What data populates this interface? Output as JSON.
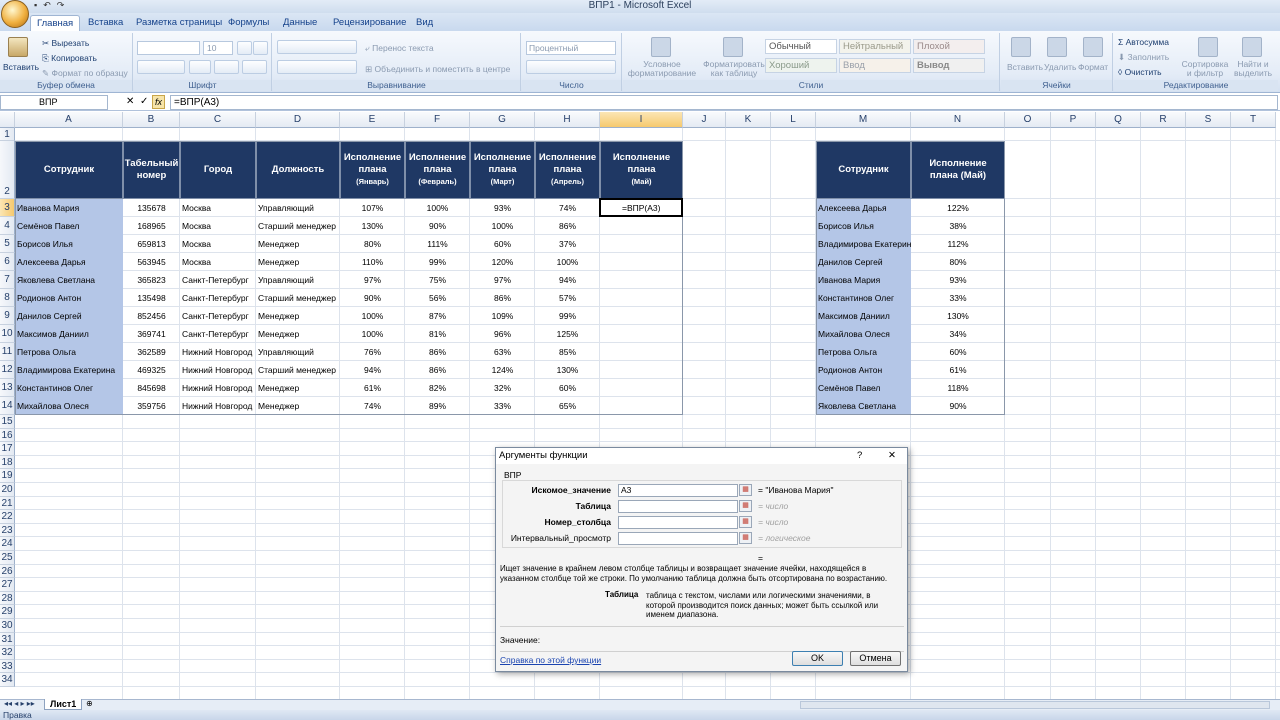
{
  "window": {
    "title": "ВПР1 - Microsoft Excel"
  },
  "tabs": [
    "Главная",
    "Вставка",
    "Разметка страницы",
    "Формулы",
    "Данные",
    "Рецензирование",
    "Вид"
  ],
  "ribbon": {
    "clipboard": {
      "paste": "Вставить",
      "cut": "Вырезать",
      "copy": "Копировать",
      "format_painter": "Формат по образцу",
      "label": "Буфер обмена"
    },
    "font": {
      "size": "10",
      "label": "Шрифт"
    },
    "alignment": {
      "wrap": "Перенос текста",
      "merge": "Объединить и поместить в центре",
      "label": "Выравнивание"
    },
    "number": {
      "format": "Процентный",
      "label": "Число"
    },
    "styles": {
      "cond_format": "Условное форматирование",
      "format_table": "Форматировать как таблицу",
      "cells": [
        "Обычный",
        "Нейтральный",
        "Плохой",
        "Хороший",
        "Ввод",
        "Вывод"
      ],
      "label": "Стили"
    },
    "cells": {
      "insert": "Вставить",
      "delete": "Удалить",
      "format": "Формат",
      "label": "Ячейки"
    },
    "editing": {
      "autosum": "Автосумма",
      "fill": "Заполнить",
      "clear": "Очистить",
      "sort": "Сортировка и фильтр",
      "find": "Найти и выделить",
      "label": "Редактирование"
    }
  },
  "formula_bar": {
    "name_box": "ВПР",
    "formula": "=ВПР(А3)"
  },
  "columns": [
    "A",
    "B",
    "C",
    "D",
    "E",
    "F",
    "G",
    "H",
    "I",
    "J",
    "K",
    "L",
    "M",
    "N",
    "O",
    "P",
    "Q",
    "R",
    "S",
    "T"
  ],
  "rows": [
    "1",
    "2",
    "3",
    "4",
    "5",
    "6",
    "7",
    "8",
    "9",
    "10",
    "11",
    "12",
    "13",
    "14",
    "15",
    "16",
    "17",
    "18",
    "19",
    "20",
    "21",
    "22",
    "23",
    "24",
    "25",
    "26",
    "27",
    "28",
    "29",
    "30",
    "31",
    "32",
    "33",
    "34"
  ],
  "table1": {
    "headers": {
      "employee": "Сотрудник",
      "tab_no": "Табельный номер",
      "city": "Город",
      "position": "Должность",
      "jan": [
        "Исполнение плана",
        "(Январь)"
      ],
      "feb": [
        "Исполнение плана",
        "(Февраль)"
      ],
      "mar": [
        "Исполнение плана",
        "(Март)"
      ],
      "apr": [
        "Исполнение плана",
        "(Апрель)"
      ],
      "may": [
        "Исполнение плана",
        "(Май)"
      ]
    },
    "rows": [
      [
        "Иванова Мария",
        "135678",
        "Москва",
        "Управляющий",
        "107%",
        "100%",
        "93%",
        "74%",
        "=ВПР(А3)"
      ],
      [
        "Семёнов Павел",
        "168965",
        "Москва",
        "Старший менеджер",
        "130%",
        "90%",
        "100%",
        "86%",
        ""
      ],
      [
        "Борисов Илья",
        "659813",
        "Москва",
        "Менеджер",
        "80%",
        "111%",
        "60%",
        "37%",
        ""
      ],
      [
        "Алексеева Дарья",
        "563945",
        "Москва",
        "Менеджер",
        "110%",
        "99%",
        "120%",
        "100%",
        ""
      ],
      [
        "Яковлева Светлана",
        "365823",
        "Санкт-Петербург",
        "Управляющий",
        "97%",
        "75%",
        "97%",
        "94%",
        ""
      ],
      [
        "Родионов Антон",
        "135498",
        "Санкт-Петербург",
        "Старший менеджер",
        "90%",
        "56%",
        "86%",
        "57%",
        ""
      ],
      [
        "Данилов Сергей",
        "852456",
        "Санкт-Петербург",
        "Менеджер",
        "100%",
        "87%",
        "109%",
        "99%",
        ""
      ],
      [
        "Максимов Даниил",
        "369741",
        "Санкт-Петербург",
        "Менеджер",
        "100%",
        "81%",
        "96%",
        "125%",
        ""
      ],
      [
        "Петрова Ольга",
        "362589",
        "Нижний Новгород",
        "Управляющий",
        "76%",
        "86%",
        "63%",
        "85%",
        ""
      ],
      [
        "Владимирова Екатерина",
        "469325",
        "Нижний Новгород",
        "Старший менеджер",
        "94%",
        "86%",
        "124%",
        "130%",
        ""
      ],
      [
        "Константинов Олег",
        "845698",
        "Нижний Новгород",
        "Менеджер",
        "61%",
        "82%",
        "32%",
        "60%",
        ""
      ],
      [
        "Михайлова Олеся",
        "359756",
        "Нижний Новгород",
        "Менеджер",
        "74%",
        "89%",
        "33%",
        "65%",
        ""
      ]
    ]
  },
  "table2": {
    "headers": {
      "employee": "Сотрудник",
      "may": "Исполнение плана (Май)"
    },
    "rows": [
      [
        "Алексеева Дарья",
        "122%"
      ],
      [
        "Борисов Илья",
        "38%"
      ],
      [
        "Владимирова Екатерина",
        "112%"
      ],
      [
        "Данилов Сергей",
        "80%"
      ],
      [
        "Иванова Мария",
        "93%"
      ],
      [
        "Константинов Олег",
        "33%"
      ],
      [
        "Максимов Даниил",
        "130%"
      ],
      [
        "Михайлова Олеся",
        "34%"
      ],
      [
        "Петрова Ольга",
        "60%"
      ],
      [
        "Родионов Антон",
        "61%"
      ],
      [
        "Семёнов Павел",
        "118%"
      ],
      [
        "Яковлева Светлана",
        "90%"
      ]
    ]
  },
  "dialog": {
    "title": "Аргументы функции",
    "help_btn": "?",
    "close_btn": "✕",
    "func": "ВПР",
    "args": [
      {
        "label": "Искомое_значение",
        "value": "А3",
        "result": "= \"Иванова Мария\"",
        "bold": true
      },
      {
        "label": "Таблица",
        "value": "",
        "result": "= число",
        "bold": true
      },
      {
        "label": "Номер_столбца",
        "value": "",
        "result": "= число",
        "bold": true
      },
      {
        "label": "Интервальный_просмотр",
        "value": "",
        "result": "= логическое",
        "bold": false
      }
    ],
    "eq": "=",
    "description": "Ищет значение в крайнем левом столбце таблицы и возвращает значение ячейки, находящейся в указанном столбце той же строки. По умолчанию таблица должна быть отсортирована по возрастанию.",
    "arg_name": "Таблица",
    "arg_desc": "таблица с текстом, числами или логическими значениями, в которой производится поиск данных; может быть ссылкой или именем диапазона.",
    "value_label": "Значение:",
    "help_link": "Справка по этой функции",
    "ok": "OK",
    "cancel": "Отмена"
  },
  "sheet_tab": "Лист1",
  "status": "Правка"
}
